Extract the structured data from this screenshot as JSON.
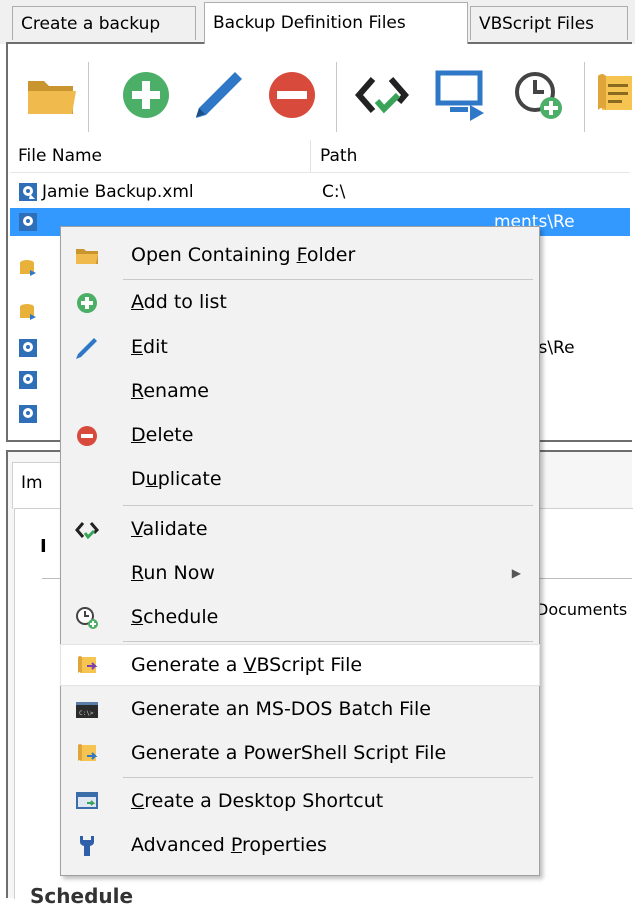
{
  "tabs": [
    {
      "label": "Create a backup",
      "active": false
    },
    {
      "label": "Backup Definition Files",
      "active": true
    },
    {
      "label": "VBScript Files",
      "active": false
    }
  ],
  "toolbar": {
    "icons": [
      "folder-open-icon",
      "add-icon",
      "edit-pencil-icon",
      "delete-icon",
      "validate-icon",
      "run-now-icon",
      "schedule-icon",
      "script-icon"
    ]
  },
  "grid": {
    "columns": [
      "File Name",
      "Path"
    ],
    "rows": [
      {
        "name": "Jamie Backup.xml",
        "path": "C:\\",
        "selected": false
      },
      {
        "name": "",
        "path": "ments\\Re",
        "selected": true
      },
      {
        "name": "",
        "path": "",
        "selected": false
      },
      {
        "name": "",
        "path": "",
        "selected": false
      },
      {
        "name": "",
        "path": "ments\\Re",
        "selected": false
      },
      {
        "name": "",
        "path": "",
        "selected": false
      },
      {
        "name": "",
        "path": "",
        "selected": false
      }
    ]
  },
  "lower": {
    "tab_label": "Im",
    "bold_text": "I",
    "documents_text": "Documents",
    "schedule_text": "Schedule"
  },
  "menu": {
    "items": [
      {
        "pre": "Open Containing ",
        "ul": "F",
        "post": "older",
        "icon": "folder-icon"
      },
      {
        "pre": "",
        "ul": "A",
        "post": "dd to list",
        "icon": "add-icon"
      },
      {
        "pre": "",
        "ul": "E",
        "post": "dit",
        "icon": "edit-pencil-icon"
      },
      {
        "pre": "",
        "ul": "R",
        "post": "ename",
        "icon": ""
      },
      {
        "pre": "",
        "ul": "D",
        "post": "elete",
        "icon": "delete-icon"
      },
      {
        "pre": "D",
        "ul": "u",
        "post": "plicate",
        "icon": ""
      },
      {
        "pre": "",
        "ul": "V",
        "post": "alidate",
        "icon": "validate-icon"
      },
      {
        "pre": "",
        "ul": "R",
        "post": "un Now",
        "icon": "",
        "submenu": true
      },
      {
        "pre": "",
        "ul": "S",
        "post": "chedule",
        "icon": "schedule-icon"
      },
      {
        "pre": "Generate a ",
        "ul": "V",
        "post": "BScript File",
        "icon": "vbscript-icon"
      },
      {
        "pre": "Generate an MS-DOS Batch File",
        "ul": "",
        "post": "",
        "icon": "batch-icon"
      },
      {
        "pre": "Generate a PowerShell Script File",
        "ul": "",
        "post": "",
        "icon": "powershell-icon"
      },
      {
        "pre": "",
        "ul": "C",
        "post": "reate a Desktop Shortcut",
        "icon": "desktop-shortcut-icon"
      },
      {
        "pre": "Advanced ",
        "ul": "P",
        "post": "roperties",
        "icon": "wrench-icon"
      }
    ],
    "submenu_arrow": "▶"
  }
}
